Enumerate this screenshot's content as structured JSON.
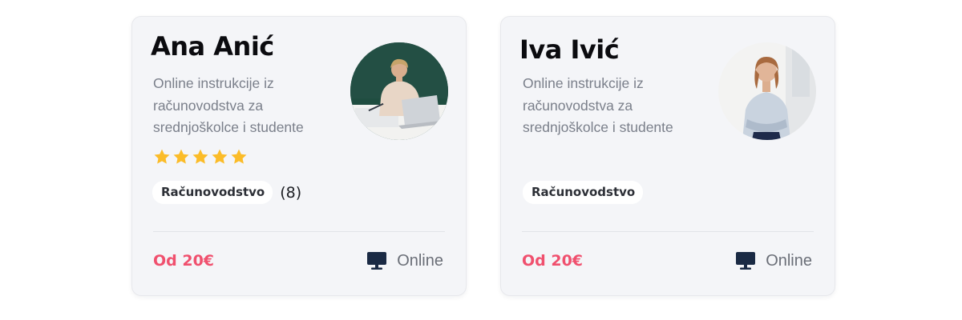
{
  "cards": [
    {
      "name": "Ana Anić",
      "description": "Online instrukcije iz računovodstva za srednjoškolce i studente",
      "avatar": "tutor-photo-woman-at-laptop",
      "rating": 5,
      "tag": "Računovodstvo",
      "review_count": "(8)",
      "price": "Od 20€",
      "mode_icon": "monitor-icon",
      "mode_label": "Online"
    },
    {
      "name": "Iva Ivić",
      "description": "Online instrukcije iz računovodstva za srednjoškolce i studente",
      "avatar": "tutor-photo-woman-arms-crossed",
      "rating": null,
      "tag": "Računovodstvo",
      "review_count": "",
      "price": "Od 20€",
      "mode_icon": "monitor-icon",
      "mode_label": "Online"
    }
  ],
  "colors": {
    "card_background": "#f4f5f8",
    "price": "#f0506e",
    "star": "#fbbc29",
    "monitor_icon": "#1a2a44"
  }
}
